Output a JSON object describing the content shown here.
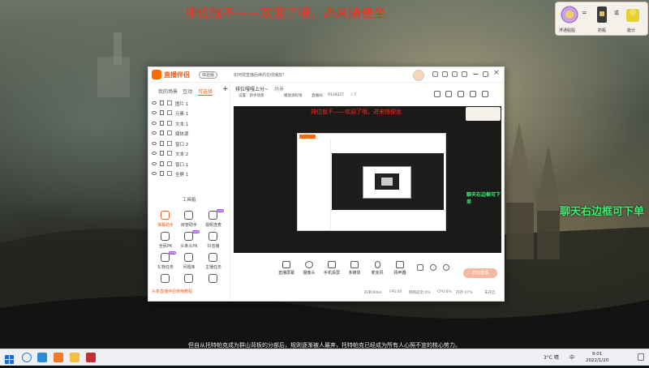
{
  "overlay": {
    "title": "排位就不——欢迎了哦，进来随便坐",
    "chat_note": "聊天右边框可下单",
    "subtitle": "但自从托特帕克成为群山背板的分部后，规则逐渐被人最弃，托特帕克已经成为所有人心照不宣的核心势力。"
  },
  "widget": {
    "labels": [
      "浮通贴贴",
      "奶瓶",
      "能计"
    ],
    "operators": [
      "=",
      "或"
    ]
  },
  "app": {
    "name": "直播伴侣",
    "beta": "体验版",
    "notice": "如何把直播后续的在线播放？",
    "left_tabs": [
      "我的场景",
      "互动",
      "可选择"
    ],
    "sources": [
      "图片 1",
      "元素 1",
      "文本 1",
      "媒体源",
      "窗口 2",
      "文本 2",
      "窗口 1",
      "全屏 1"
    ],
    "tool_header": "工具箱",
    "tools": [
      {
        "label": "弹幕助手",
        "icon": "danmaku-icon",
        "badge": ""
      },
      {
        "label": "房管助手",
        "icon": "user-admin-icon",
        "badge": ""
      },
      {
        "label": "视频连麦",
        "icon": "video-link-icon",
        "badge": "new"
      },
      {
        "label": "全民PK",
        "icon": "pk-icon",
        "badge": ""
      },
      {
        "label": "头条头PK",
        "icon": "headline-pk-icon",
        "badge": "new"
      },
      {
        "label": "抖音播",
        "icon": "douyin-play-icon",
        "badge": ""
      },
      {
        "label": "礼物任务",
        "icon": "gift-task-icon",
        "badge": "new"
      },
      {
        "label": "问题库",
        "icon": "question-bank-icon",
        "badge": ""
      },
      {
        "label": "主播任务",
        "icon": "host-task-icon",
        "badge": ""
      },
      {
        "label": "",
        "icon": "search-tool-icon",
        "badge": ""
      },
      {
        "label": "",
        "icon": "upload-tool-icon",
        "badge": ""
      },
      {
        "label": "",
        "icon": "cloud-tool-icon",
        "badge": ""
      }
    ],
    "tool_footer": "头条直播伴侣使用教程",
    "scene_tab": "排位嘎嘎上分~",
    "scene_tab_extra": "场景",
    "meta": [
      "设置：新手场景",
      "播放源权限",
      "直播间：",
      "9130227",
      "♪ 7"
    ],
    "bottom_buttons": [
      "直播屏幕",
      "摄像头",
      "手机投屏",
      "多媒体",
      "麦克风",
      "扬声器"
    ],
    "go_live": "开始直播",
    "status": [
      "码率0Kb/s",
      "FPS:60",
      "网络延迟:0%",
      "CPU:0%",
      "内存:47%",
      "未开启"
    ]
  },
  "preview": {
    "title": "排位就不——欢迎了哦，进来随便坐",
    "chat_note": "聊天右边框可下单"
  },
  "taskbar": {
    "temp": "3°C 晴",
    "ime": "中",
    "time": "9:01",
    "date": "2022/1/20"
  },
  "colors": {
    "brand": "#f05a1a",
    "title_red": "#ff2a1a",
    "chat_green": "#3cf070"
  }
}
